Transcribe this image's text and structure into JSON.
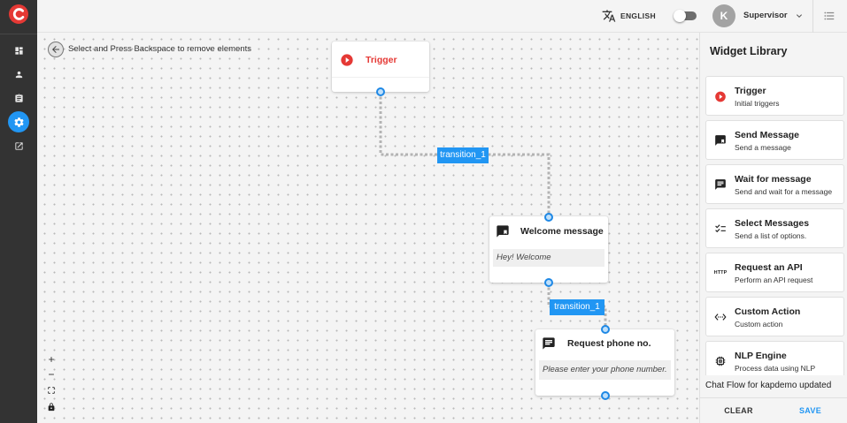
{
  "colors": {
    "sidebar_bg": "#333333",
    "accent": "#2196f3",
    "trigger_red": "#e53935",
    "canvas_bg": "#f4f4f4"
  },
  "app": {
    "logo_icon": "app-logo-icon"
  },
  "sidebar": {
    "items": [
      {
        "icon": "dashboard-icon",
        "active": false
      },
      {
        "icon": "user-icon",
        "active": false
      },
      {
        "icon": "clipboard-icon",
        "active": false
      },
      {
        "icon": "gear-icon",
        "active": true
      },
      {
        "icon": "external-link-icon",
        "active": false
      }
    ]
  },
  "header": {
    "language_icon": "translate-icon",
    "language_label": "ENGLISH",
    "toggle_on": false,
    "avatar_initial": "K",
    "user_role": "Supervisor",
    "user_menu_icon": "chevron-down-icon",
    "panel_toggle_icon": "list-icon"
  },
  "canvas": {
    "hint_icon": "arrow-back-icon",
    "hint": "Select and Press Backspace to remove elements",
    "nodes": [
      {
        "title": "Trigger",
        "icon": "play-circle-icon"
      },
      {
        "title": "Welcome message",
        "icon": "send-message-icon",
        "message": "Hey! Welcome"
      },
      {
        "title": "Request phone no.",
        "icon": "chat-icon",
        "message": "Please enter your phone number."
      }
    ],
    "edges": [
      {
        "label": "transition_1"
      },
      {
        "label": "transition_1"
      }
    ],
    "controls": [
      {
        "icon": "zoom-in-icon"
      },
      {
        "icon": "zoom-out-icon"
      },
      {
        "icon": "fit-view-icon"
      },
      {
        "icon": "lock-icon"
      }
    ]
  },
  "widget_library": {
    "title": "Widget Library",
    "widgets": [
      {
        "title": "Trigger",
        "description": "Initial triggers",
        "icon": "play-circle-icon"
      },
      {
        "title": "Send Message",
        "description": "Send a message",
        "icon": "send-message-icon"
      },
      {
        "title": "Wait for message",
        "description": "Send and wait for a message",
        "icon": "chat-icon"
      },
      {
        "title": "Select Messages",
        "description": "Send a list of options.",
        "icon": "checklist-icon"
      },
      {
        "title": "Request an API",
        "description": "Perform an API request",
        "icon": "http-icon",
        "icon_text": "HTTP"
      },
      {
        "title": "Custom Action",
        "description": "Custom action",
        "icon": "code-icon"
      },
      {
        "title": "NLP Engine",
        "description": "Process data using NLP",
        "icon": "memory-chip-icon"
      }
    ],
    "toast": "Chat Flow for kapdemo updated",
    "clear_label": "CLEAR",
    "save_label": "SAVE"
  }
}
